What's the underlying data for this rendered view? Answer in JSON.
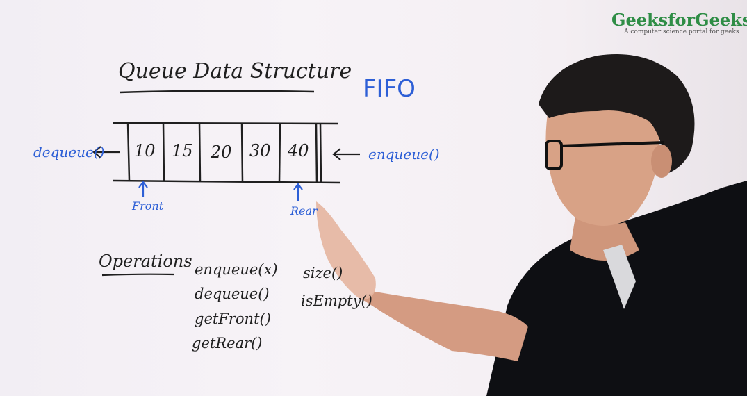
{
  "brand": {
    "name": "GeeksforGeeks",
    "tagline": "A computer science portal for geeks"
  },
  "board": {
    "title": "Queue Data Structure",
    "fifo": "FIFO",
    "queue_values": [
      "10",
      "15",
      "20",
      "30",
      "40"
    ],
    "dequeue_label": "dequeue()",
    "enqueue_label": "enqueue()",
    "front_label": "Front",
    "rear_label": "Rear",
    "operations_heading": "Operations",
    "operations_col1": [
      "enqueue(x)",
      "dequeue()",
      "getFront()",
      "getRear()"
    ],
    "operations_col2": [
      "size()",
      "isEmpty()"
    ]
  },
  "colors": {
    "ink": "#1f1f1f",
    "marker_blue": "#2d5fd6",
    "brand_green": "#2f8d46",
    "board": "#f4f0f4",
    "shirt": "#0e0f13"
  }
}
